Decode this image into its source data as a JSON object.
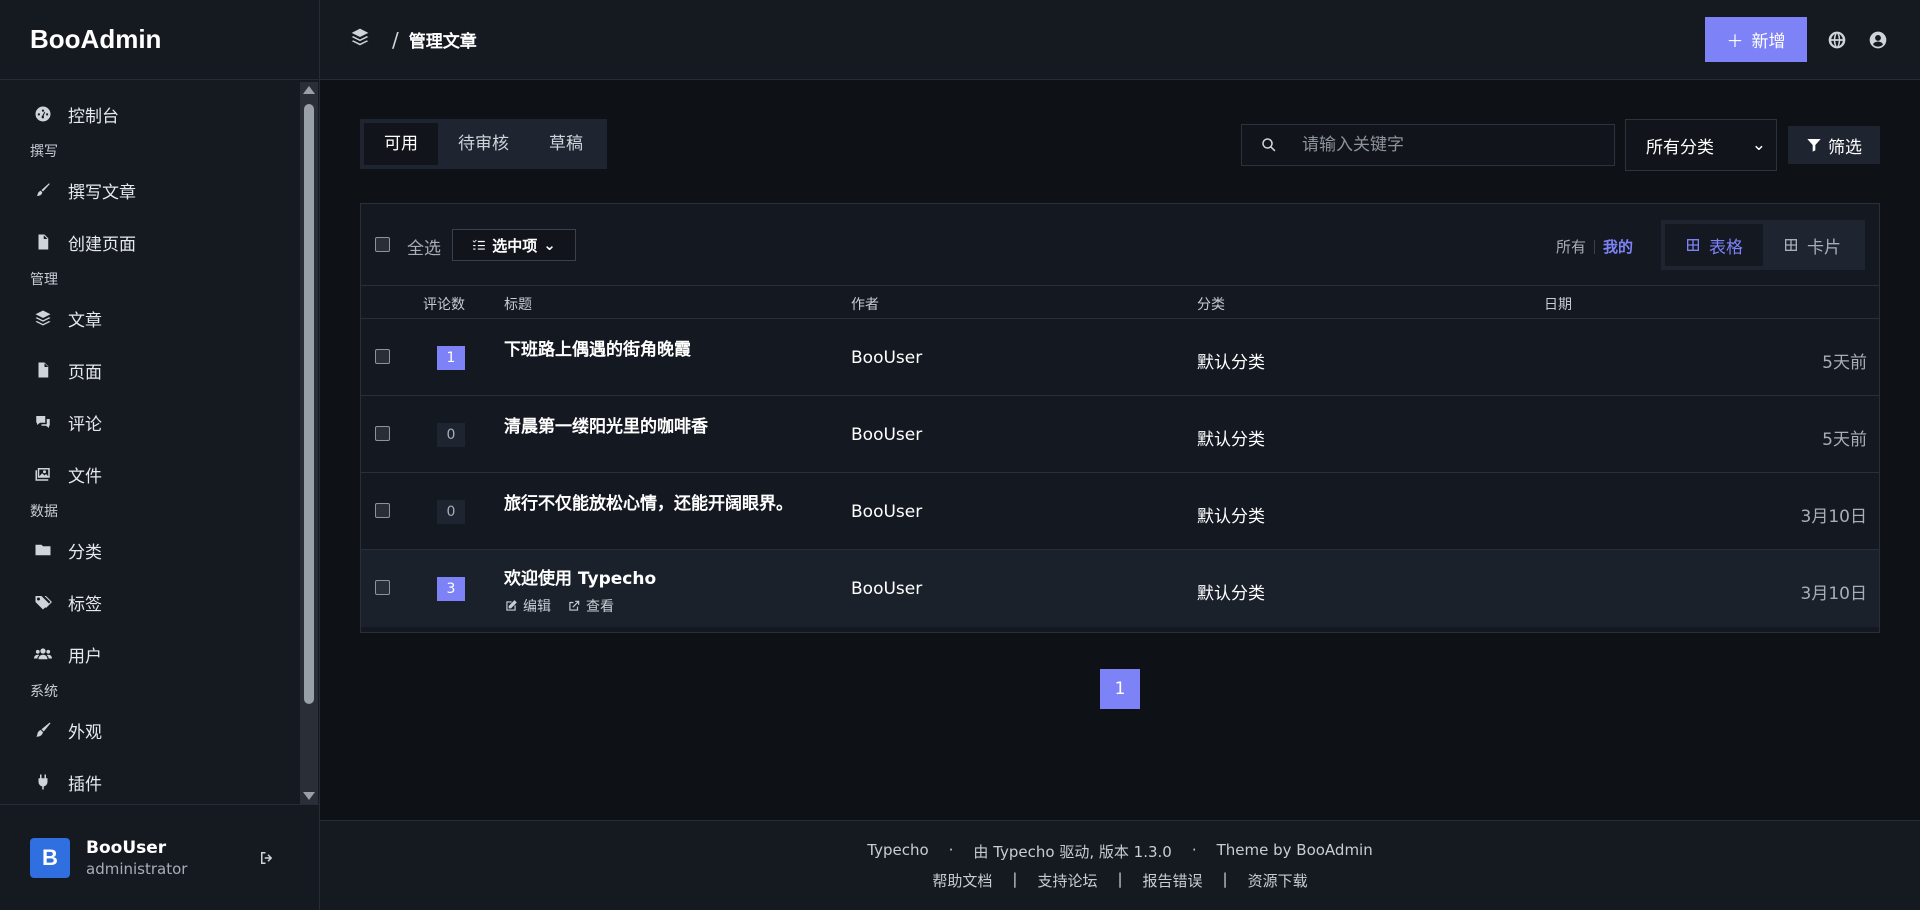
{
  "brand": "BooAdmin",
  "sidebar": {
    "items": [
      {
        "type": "item",
        "label": "控制台",
        "icon": "dashboard-icon"
      },
      {
        "type": "group",
        "label": "撰写"
      },
      {
        "type": "item",
        "label": "撰写文章",
        "icon": "pen-icon"
      },
      {
        "type": "item",
        "label": "创建页面",
        "icon": "file-icon"
      },
      {
        "type": "group",
        "label": "管理"
      },
      {
        "type": "item",
        "label": "文章",
        "icon": "layers-icon"
      },
      {
        "type": "item",
        "label": "页面",
        "icon": "page-icon"
      },
      {
        "type": "item",
        "label": "评论",
        "icon": "comments-icon"
      },
      {
        "type": "item",
        "label": "文件",
        "icon": "images-icon"
      },
      {
        "type": "group",
        "label": "数据"
      },
      {
        "type": "item",
        "label": "分类",
        "icon": "folder-icon"
      },
      {
        "type": "item",
        "label": "标签",
        "icon": "tags-icon"
      },
      {
        "type": "item",
        "label": "用户",
        "icon": "users-icon"
      },
      {
        "type": "group",
        "label": "系统"
      },
      {
        "type": "item",
        "label": "外观",
        "icon": "brush-icon"
      },
      {
        "type": "item",
        "label": "插件",
        "icon": "plug-icon"
      }
    ]
  },
  "user": {
    "initial": "B",
    "name": "BooUser",
    "role": "administrator"
  },
  "header": {
    "breadcrumb_sep": "/",
    "title": "管理文章",
    "add_label": "新增"
  },
  "tabs": [
    {
      "label": "可用",
      "active": true
    },
    {
      "label": "待审核",
      "active": false
    },
    {
      "label": "草稿",
      "active": false
    }
  ],
  "search": {
    "placeholder": "请输入关键字"
  },
  "category_filter": {
    "selected": "所有分类"
  },
  "filter_label": "筛选",
  "toolbar": {
    "select_all": "全选",
    "selection_menu": "选中项",
    "owner_all": "所有",
    "owner_mine": "我的",
    "view_table": "表格",
    "view_card": "卡片"
  },
  "table": {
    "headers": {
      "comments": "评论数",
      "title": "标题",
      "author": "作者",
      "category": "分类",
      "date": "日期"
    },
    "rows": [
      {
        "comments": "1",
        "hot": true,
        "title": "下班路上偶遇的街角晚霞",
        "author": "BooUser",
        "category": "默认分类",
        "date": "5天前"
      },
      {
        "comments": "0",
        "hot": false,
        "title": "清晨第一缕阳光里的咖啡香",
        "author": "BooUser",
        "category": "默认分类",
        "date": "5天前"
      },
      {
        "comments": "0",
        "hot": false,
        "title": "旅行不仅能放松心情，还能开阔眼界。",
        "author": "BooUser",
        "category": "默认分类",
        "date": "3月10日"
      },
      {
        "comments": "3",
        "hot": true,
        "title": "欢迎使用 Typecho",
        "author": "BooUser",
        "category": "默认分类",
        "date": "3月10日",
        "edit": "编辑",
        "view": "查看"
      }
    ]
  },
  "pagination": {
    "current": "1"
  },
  "footer": {
    "site": "Typecho",
    "powered": "由 Typecho 驱动, 版本 1.3.0",
    "theme": "Theme by BooAdmin",
    "links": [
      "帮助文档",
      "支持论坛",
      "报告错误",
      "资源下载"
    ]
  },
  "colors": {
    "accent": "#7e82f7",
    "avatar": "#2f6fe0",
    "bg": "#0e1116"
  }
}
